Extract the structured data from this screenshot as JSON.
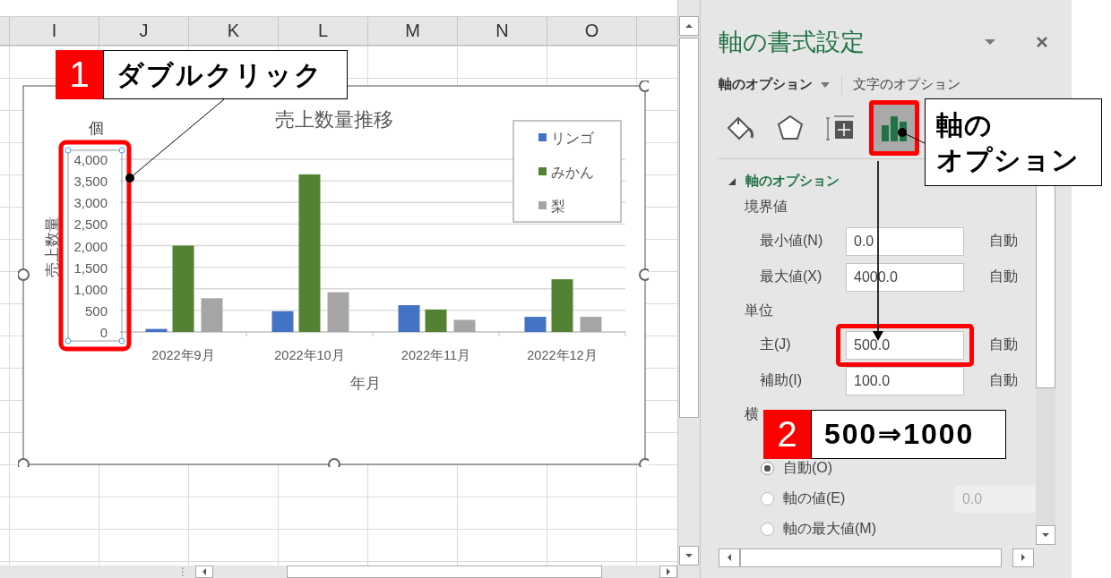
{
  "sheet": {
    "columns": [
      "I",
      "J",
      "K",
      "L",
      "M",
      "N",
      "O"
    ],
    "split_glyph": "⋮"
  },
  "chart": {
    "unit_label": "個",
    "axis_selected": true,
    "axis_highlighted": true,
    "chart_data": {
      "type": "bar",
      "title": "売上数量推移",
      "xlabel": "年月",
      "ylabel": "売上数量",
      "categories": [
        "2022年9月",
        "2022年10月",
        "2022年11月",
        "2022年12月"
      ],
      "series": [
        {
          "name": "リンゴ",
          "color": "#4472c4",
          "values": [
            70,
            480,
            620,
            350
          ]
        },
        {
          "name": "みかん",
          "color": "#548235",
          "values": [
            2000,
            3650,
            520,
            1220
          ]
        },
        {
          "name": "梨",
          "color": "#a5a5a5",
          "values": [
            780,
            920,
            280,
            350
          ]
        }
      ],
      "ylim": [
        0,
        4000
      ],
      "grid": true,
      "legend": "top-right",
      "yticks": [
        {
          "value": 0,
          "label": "0"
        },
        {
          "value": 500,
          "label": "500"
        },
        {
          "value": 1000,
          "label": "1,000"
        },
        {
          "value": 1500,
          "label": "1,500"
        },
        {
          "value": 2000,
          "label": "2,000"
        },
        {
          "value": 2500,
          "label": "2,500"
        },
        {
          "value": 3000,
          "label": "3,000"
        },
        {
          "value": 3500,
          "label": "3,500"
        },
        {
          "value": 4000,
          "label": "4,000"
        }
      ]
    }
  },
  "pane": {
    "title": "軸の書式設定",
    "tabs": [
      {
        "label": "軸のオプション",
        "selected": true
      },
      {
        "label": "文字のオプション",
        "selected": false
      }
    ],
    "icon_tabs": [
      {
        "kind": "fill",
        "selected": false,
        "highlighted": false
      },
      {
        "kind": "effects",
        "selected": false,
        "highlighted": false
      },
      {
        "kind": "size",
        "selected": false,
        "highlighted": false
      },
      {
        "kind": "axis",
        "selected": true,
        "highlighted": true
      }
    ],
    "section": {
      "title": "軸のオプション",
      "expanded": true
    },
    "items": [
      {
        "kind": "group",
        "label": "境界値"
      },
      {
        "kind": "field",
        "label": "最小値(N)",
        "value": "0.0",
        "reset": "自動",
        "highlighted": false
      },
      {
        "kind": "field",
        "label": "最大値(X)",
        "value": "4000.0",
        "reset": "自動",
        "highlighted": false
      },
      {
        "kind": "group",
        "label": "単位"
      },
      {
        "kind": "field",
        "label": "主(J)",
        "value": "500.0",
        "reset": "自動",
        "highlighted": true
      },
      {
        "kind": "field",
        "label": "補助(I)",
        "value": "100.0",
        "reset": "自動",
        "highlighted": false
      },
      {
        "kind": "group",
        "label": "横"
      },
      {
        "kind": "radio",
        "label": "自動(O)",
        "selected": true
      },
      {
        "kind": "radio",
        "label": "軸の値(E)",
        "selected": false,
        "value": "0.0",
        "disabled": true
      },
      {
        "kind": "radio",
        "label": "軸の最大値(M)",
        "selected": false
      }
    ]
  },
  "callouts": [
    {
      "kind": "numbered",
      "number": "1",
      "text": "ダブルクリック"
    },
    {
      "kind": "plain",
      "lines": [
        "軸の",
        "オプション"
      ]
    },
    {
      "kind": "numbered",
      "number": "2",
      "text": "500⇒1000"
    }
  ]
}
